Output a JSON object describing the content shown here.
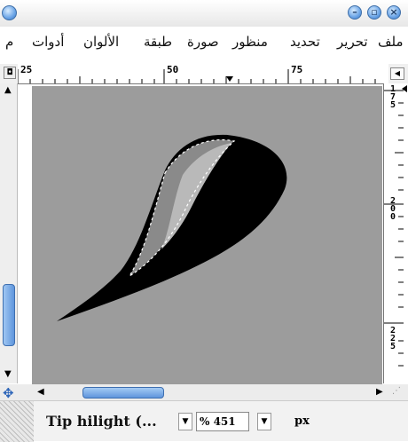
{
  "menu": {
    "items": [
      "ملف",
      "تحرير",
      "تحديد",
      "منظور",
      "صورة",
      "طبقة",
      "الألوان",
      "أدوات",
      "م"
    ]
  },
  "ruler": {
    "h_labels": [
      "25",
      "50",
      "75"
    ],
    "v_labels": [
      "175",
      "200",
      "225"
    ]
  },
  "status": {
    "layer_name": "Tip hilight (...",
    "zoom": "% 451",
    "unit": "px"
  },
  "colors": {
    "canvas_bg": "#9c9c9c",
    "accent": "#5f95dc"
  }
}
